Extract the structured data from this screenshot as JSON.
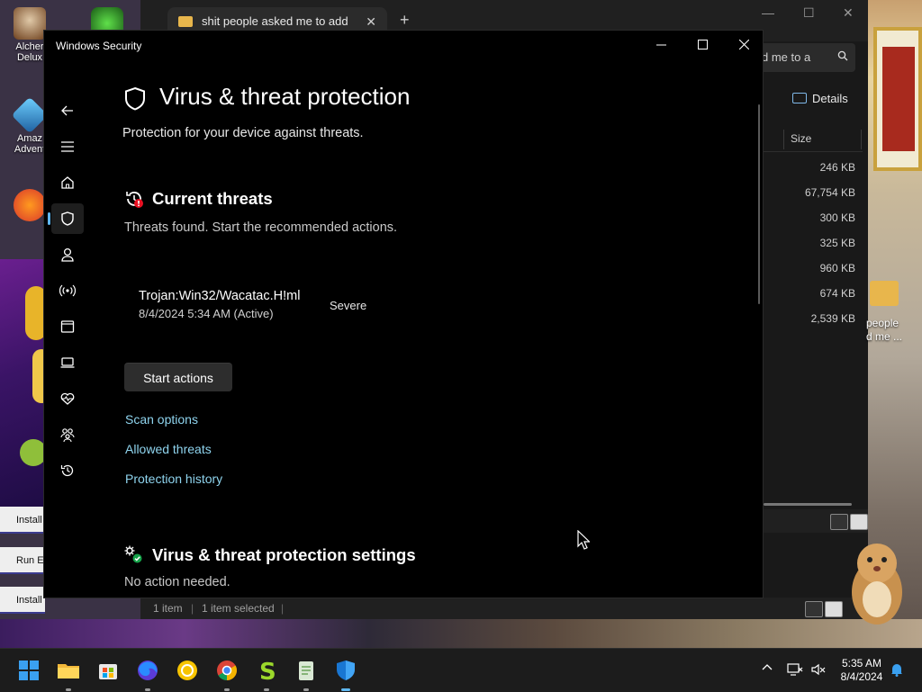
{
  "desktop": {
    "icons": [
      {
        "label": "Alcher Delux"
      },
      {
        "label": "Amaz Advent"
      }
    ],
    "side_items": [
      "Install",
      "Run E",
      "Install Game Collection"
    ],
    "folder": {
      "label": "people\nd me ..."
    }
  },
  "explorer": {
    "tab_title": "shit people asked me to add",
    "search_text": "d me to a",
    "details_label": "Details",
    "column_size": "Size",
    "sizes": [
      "246 KB",
      "67,754 KB",
      "300 KB",
      "325 KB",
      "960 KB",
      "674 KB",
      "2,539 KB"
    ],
    "status_items": "1 item",
    "status_selected": "1 item selected"
  },
  "security": {
    "window_title": "Windows Security",
    "page_title": "Virus & threat protection",
    "page_subtitle": "Protection for your device against threats.",
    "current_threats": {
      "title": "Current threats",
      "desc": "Threats found. Start the recommended actions.",
      "threat_name": "Trojan:Win32/Wacatac.H!ml",
      "threat_date": "8/4/2024 5:34 AM (Active)",
      "severity": "Severe",
      "start_button": "Start actions",
      "links": [
        "Scan options",
        "Allowed threats",
        "Protection history"
      ]
    },
    "settings": {
      "title": "Virus & threat protection settings",
      "desc": "No action needed."
    },
    "nav": [
      "back-icon",
      "menu-icon",
      "home-icon",
      "shield-icon",
      "account-icon",
      "firewall-icon",
      "app-browser-icon",
      "device-security-icon",
      "device-health-icon",
      "family-icon",
      "history-icon",
      "settings-icon"
    ]
  },
  "taskbar": {
    "time": "5:35 AM",
    "date": "8/4/2024",
    "apps": [
      "start-icon",
      "file-explorer-icon",
      "store-icon",
      "firefox-icon",
      "norton-icon",
      "chrome-icon",
      "app-s-icon",
      "notepad-icon",
      "windows-security-icon"
    ]
  },
  "colors": {
    "accent": "#5fb7f0",
    "link": "#8fd4ee",
    "window_bg": "#000000",
    "button_bg": "#2d2d2d"
  }
}
